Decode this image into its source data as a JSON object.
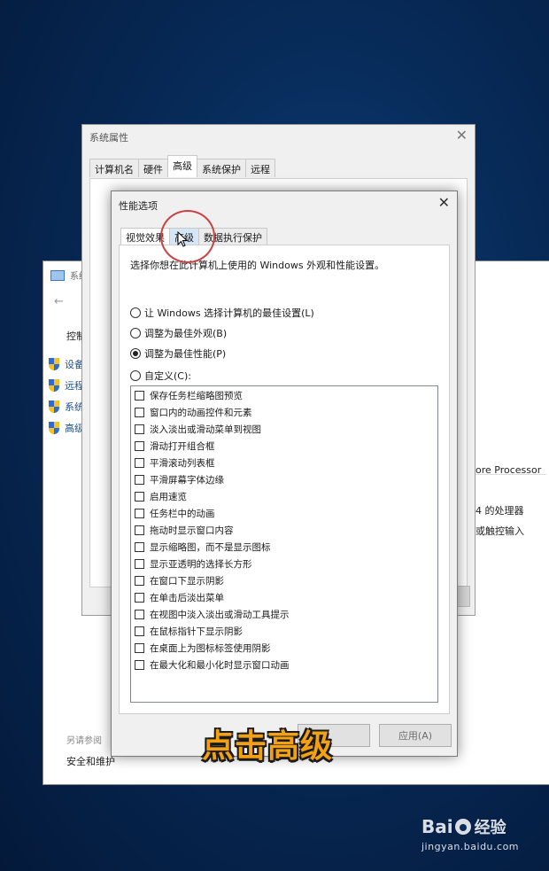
{
  "control_panel": {
    "title": "系统",
    "home": "控制",
    "links": [
      "设备",
      "远程",
      "系统",
      "高级"
    ],
    "processor_text": "ore Processor",
    "processor_line": "4 的处理器",
    "touch_line": "或触控输入",
    "see_also": "另请参阅",
    "security": "安全和维护"
  },
  "system_properties": {
    "title": "系统属性",
    "tabs": [
      "计算机名",
      "硬件",
      "高级",
      "系统保护",
      "远程"
    ],
    "active_tab": "高级"
  },
  "performance_options": {
    "title": "性能选项",
    "tabs": [
      "视觉效果",
      "高级",
      "数据执行保护"
    ],
    "intro": "选择你想在此计算机上使用的 Windows 外观和性能设置。",
    "radios": [
      {
        "label": "让 Windows 选择计算机的最佳设置(L)",
        "checked": false
      },
      {
        "label": "调整为最佳外观(B)",
        "checked": false
      },
      {
        "label": "调整为最佳性能(P)",
        "checked": true
      },
      {
        "label": "自定义(C):",
        "checked": false
      }
    ],
    "options": [
      "保存任务栏缩略图预览",
      "窗口内的动画控件和元素",
      "淡入淡出或滑动菜单到视图",
      "滑动打开组合框",
      "平滑滚动列表框",
      "平滑屏幕字体边缘",
      "启用速览",
      "任务栏中的动画",
      "拖动时显示窗口内容",
      "显示缩略图，而不是显示图标",
      "显示亚透明的选择长方形",
      "在窗口下显示阴影",
      "在单击后淡出菜单",
      "在视图中淡入淡出或滑动工具提示",
      "在鼠标指针下显示阴影",
      "在桌面上为图标标签使用阴影",
      "在最大化和最小化时显示窗口动画"
    ],
    "apply_button": "应用(A)"
  },
  "caption": "点击高级",
  "watermark": {
    "brand": "Bai",
    "brand2": "经验",
    "url": "jingyan.baidu.com"
  }
}
